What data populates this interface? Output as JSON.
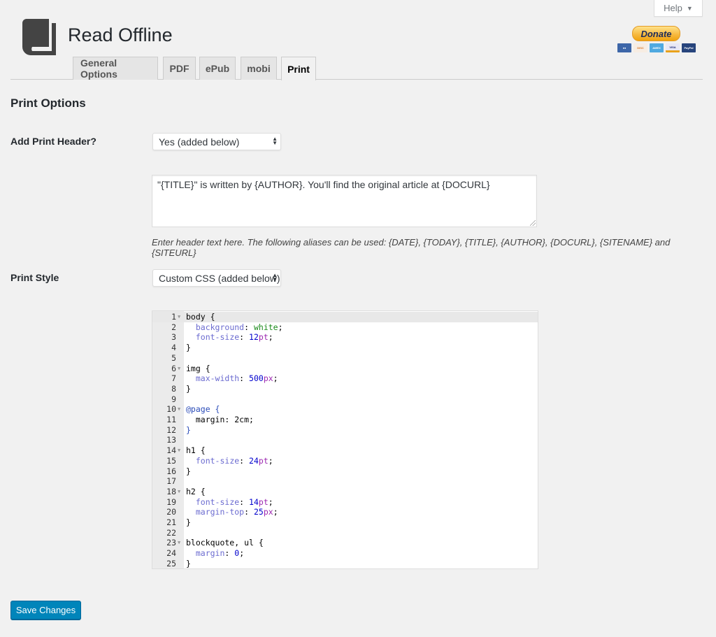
{
  "help": {
    "label": "Help",
    "icon": "caret-down-icon"
  },
  "app": {
    "title": "Read Offline",
    "logo_icon": "book-icon"
  },
  "donate": {
    "label": "Donate",
    "cards": [
      "MasterCard",
      "Discover",
      "AMEX",
      "VISA",
      "PayPal"
    ]
  },
  "tabs": [
    {
      "label": "General Options",
      "active": false
    },
    {
      "label": "PDF",
      "active": false
    },
    {
      "label": "ePub",
      "active": false
    },
    {
      "label": "mobi",
      "active": false
    },
    {
      "label": "Print",
      "active": true
    }
  ],
  "section": {
    "title": "Print Options"
  },
  "print_header": {
    "label": "Add Print Header?",
    "selected": "Yes (added below)",
    "text": "\"{TITLE}\" is written by {AUTHOR}. You'll find the original article at {DOCURL}",
    "hint": "Enter header text here. The following aliases can be used: {DATE}, {TODAY}, {TITLE}, {AUTHOR}, {DOCURL}, {SITENAME} and {SITEURL}"
  },
  "print_style": {
    "label": "Print Style",
    "selected": "Custom CSS (added below)"
  },
  "css_editor": {
    "lines": [
      {
        "n": "1",
        "fold": true,
        "tokens": [
          [
            "",
            "body {"
          ]
        ]
      },
      {
        "n": "2",
        "fold": false,
        "tokens": [
          [
            "",
            "  "
          ],
          [
            "prop",
            "background"
          ],
          [
            "",
            ": "
          ],
          [
            "str",
            "white"
          ],
          [
            "",
            ";"
          ]
        ]
      },
      {
        "n": "3",
        "fold": false,
        "tokens": [
          [
            "",
            "  "
          ],
          [
            "prop",
            "font-size"
          ],
          [
            "",
            ": "
          ],
          [
            "num",
            "12"
          ],
          [
            "unit",
            "pt"
          ],
          [
            "",
            ";"
          ]
        ]
      },
      {
        "n": "4",
        "fold": false,
        "tokens": [
          [
            "",
            "}"
          ]
        ]
      },
      {
        "n": "5",
        "fold": false,
        "tokens": []
      },
      {
        "n": "6",
        "fold": true,
        "tokens": [
          [
            "",
            "img {"
          ]
        ]
      },
      {
        "n": "7",
        "fold": false,
        "tokens": [
          [
            "",
            "  "
          ],
          [
            "prop",
            "max-width"
          ],
          [
            "",
            ": "
          ],
          [
            "num",
            "500"
          ],
          [
            "unit",
            "px"
          ],
          [
            "",
            ";"
          ]
        ]
      },
      {
        "n": "8",
        "fold": false,
        "tokens": [
          [
            "",
            "}"
          ]
        ]
      },
      {
        "n": "9",
        "fold": false,
        "tokens": []
      },
      {
        "n": "10",
        "fold": true,
        "tokens": [
          [
            "at",
            "@page {"
          ]
        ]
      },
      {
        "n": "11",
        "fold": false,
        "tokens": [
          [
            "",
            "  margin: 2cm;"
          ]
        ]
      },
      {
        "n": "12",
        "fold": false,
        "tokens": [
          [
            "at",
            "}"
          ]
        ]
      },
      {
        "n": "13",
        "fold": false,
        "tokens": []
      },
      {
        "n": "14",
        "fold": true,
        "tokens": [
          [
            "",
            "h1 {"
          ]
        ]
      },
      {
        "n": "15",
        "fold": false,
        "tokens": [
          [
            "",
            "  "
          ],
          [
            "prop",
            "font-size"
          ],
          [
            "",
            ": "
          ],
          [
            "num",
            "24"
          ],
          [
            "unit",
            "pt"
          ],
          [
            "",
            ";"
          ]
        ]
      },
      {
        "n": "16",
        "fold": false,
        "tokens": [
          [
            "",
            "}"
          ]
        ]
      },
      {
        "n": "17",
        "fold": false,
        "tokens": []
      },
      {
        "n": "18",
        "fold": true,
        "tokens": [
          [
            "",
            "h2 {"
          ]
        ]
      },
      {
        "n": "19",
        "fold": false,
        "tokens": [
          [
            "",
            "  "
          ],
          [
            "prop",
            "font-size"
          ],
          [
            "",
            ": "
          ],
          [
            "num",
            "14"
          ],
          [
            "unit",
            "pt"
          ],
          [
            "",
            ";"
          ]
        ]
      },
      {
        "n": "20",
        "fold": false,
        "tokens": [
          [
            "",
            "  "
          ],
          [
            "prop",
            "margin-top"
          ],
          [
            "",
            ": "
          ],
          [
            "num",
            "25"
          ],
          [
            "unit",
            "px"
          ],
          [
            "",
            ";"
          ]
        ]
      },
      {
        "n": "21",
        "fold": false,
        "tokens": [
          [
            "",
            "}"
          ]
        ]
      },
      {
        "n": "22",
        "fold": false,
        "tokens": []
      },
      {
        "n": "23",
        "fold": true,
        "tokens": [
          [
            "",
            "blockquote, ul {"
          ]
        ]
      },
      {
        "n": "24",
        "fold": false,
        "tokens": [
          [
            "",
            "  "
          ],
          [
            "prop",
            "margin"
          ],
          [
            "",
            ": "
          ],
          [
            "num",
            "0"
          ],
          [
            "",
            ";"
          ]
        ]
      },
      {
        "n": "25",
        "fold": false,
        "tokens": [
          [
            "",
            "}"
          ]
        ]
      }
    ]
  },
  "save_button": {
    "label": "Save Changes"
  },
  "colors": {
    "primary_button": "#0085ba",
    "background": "#f1f1f1"
  }
}
